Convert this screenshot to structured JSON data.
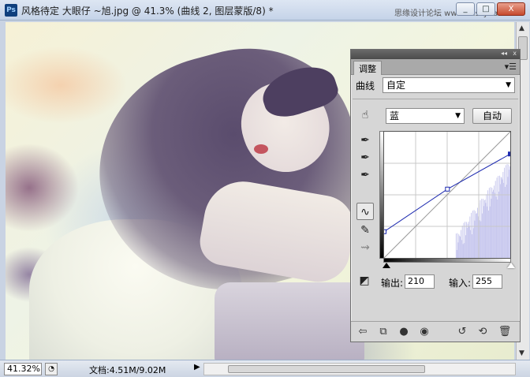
{
  "window": {
    "app_icon": "Ps",
    "title": "风格待定 大眼仔 ~旭.jpg @ 41.3% (曲线 2, 图层蒙版/8) *",
    "watermark": "思缘设计论坛 www.missyuan.com",
    "controls": {
      "minimize": "_",
      "maximize": "□",
      "close": "X"
    }
  },
  "panel": {
    "collapse_label": "◂◂",
    "close_label": "x",
    "tab_label": "调整",
    "menu_icon": "menu-icon",
    "curve_label": "曲线",
    "preset_value": "自定",
    "channel_value": "蓝",
    "auto_button": "自动",
    "output_label": "输出:",
    "output_value": "210",
    "input_label": "输入:",
    "input_value": "255",
    "curve_points": [
      {
        "input": 0,
        "output": 53
      },
      {
        "input": 128,
        "output": 139
      },
      {
        "input": 255,
        "output": 210
      }
    ],
    "curve_color": "#1e2bb0",
    "histogram_color": "#c8c8ee"
  },
  "status": {
    "zoom": "41.32%",
    "doc_info": "文档:4.51M/9.02M",
    "arrow": "▶"
  }
}
